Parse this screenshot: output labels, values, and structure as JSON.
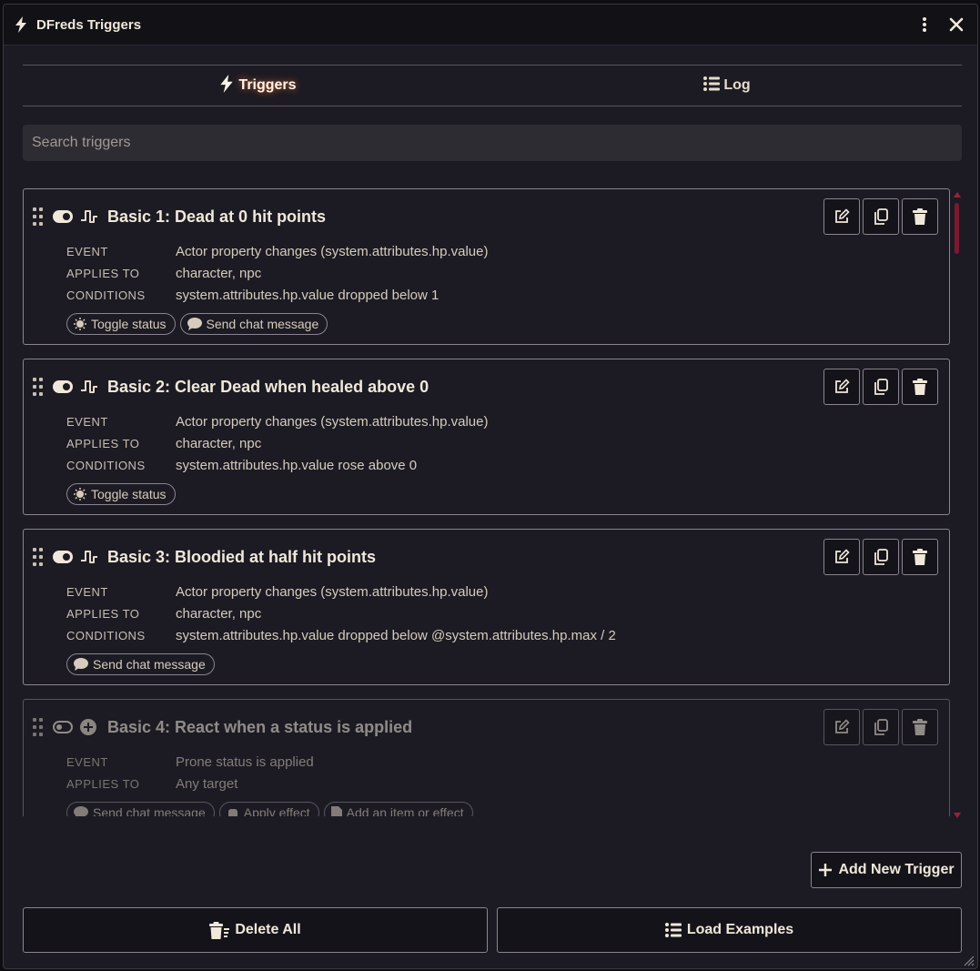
{
  "window": {
    "title": "DFreds Triggers"
  },
  "tabs": [
    {
      "label": "Triggers",
      "icon": "bolt-icon",
      "active": true
    },
    {
      "label": "Log",
      "icon": "list-icon",
      "active": false
    }
  ],
  "search": {
    "placeholder": "Search triggers",
    "value": ""
  },
  "labels": {
    "event": "EVENT",
    "applies_to": "APPLIES TO",
    "conditions": "CONDITIONS"
  },
  "triggers": [
    {
      "title": "Basic 1: Dead at 0 hit points",
      "enabled": true,
      "event": "Actor property changes (system.attributes.hp.value)",
      "applies_to": "character, npc",
      "conditions": "system.attributes.hp.value dropped below 1",
      "actions": [
        "Toggle status",
        "Send chat message"
      ]
    },
    {
      "title": "Basic 2: Clear Dead when healed above 0",
      "enabled": true,
      "event": "Actor property changes (system.attributes.hp.value)",
      "applies_to": "character, npc",
      "conditions": "system.attributes.hp.value rose above 0",
      "actions": [
        "Toggle status"
      ]
    },
    {
      "title": "Basic 3: Bloodied at half hit points",
      "enabled": true,
      "event": "Actor property changes (system.attributes.hp.value)",
      "applies_to": "character, npc",
      "conditions": "system.attributes.hp.value dropped below @system.attributes.hp.max / 2",
      "actions": [
        "Send chat message"
      ]
    },
    {
      "title": "Basic 4: React when a status is applied",
      "enabled": false,
      "event": "Prone status is applied",
      "applies_to": "Any target",
      "actions": [
        "Send chat message",
        "Apply effect",
        "Add an item or effect"
      ]
    }
  ],
  "buttons": {
    "add_new": "Add New Trigger",
    "delete_all": "Delete All",
    "load_examples": "Load Examples"
  },
  "colors": {
    "accent": "#a0203a",
    "background": "#1c1b23",
    "text": "#e6dccb"
  }
}
